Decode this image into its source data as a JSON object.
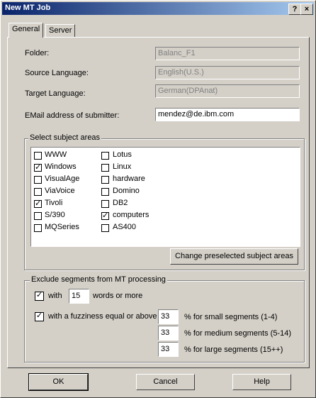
{
  "window": {
    "title": "New MT Job",
    "help_btn": "?",
    "close_btn": "×"
  },
  "tabs": [
    {
      "label": "General"
    },
    {
      "label": "Server"
    }
  ],
  "form": {
    "folder_label": "Folder:",
    "folder_value": "Balanc_F1",
    "source_label": "Source Language:",
    "source_value": "English(U.S.)",
    "target_label": "Target Language:",
    "target_value": "German(DPAnat)",
    "email_label": "EMail address of submitter:",
    "email_value": "mendez@de.ibm.com"
  },
  "subjects": {
    "title": "Select subject areas",
    "col1": [
      {
        "label": "WWW",
        "checked": false,
        "mark": ""
      },
      {
        "label": "Windows",
        "checked": true,
        "mark": "✓"
      },
      {
        "label": "VisualAge",
        "checked": false,
        "mark": ""
      },
      {
        "label": "ViaVoice",
        "checked": false,
        "mark": ""
      },
      {
        "label": "Tivoli",
        "checked": true,
        "mark": "✓"
      },
      {
        "label": "S/390",
        "checked": false,
        "mark": ""
      },
      {
        "label": "MQSeries",
        "checked": false,
        "mark": ""
      }
    ],
    "col2": [
      {
        "label": "Lotus",
        "checked": false,
        "mark": ""
      },
      {
        "label": "Linux",
        "checked": false,
        "mark": ""
      },
      {
        "label": "hardware",
        "checked": false,
        "mark": ""
      },
      {
        "label": "Domino",
        "checked": false,
        "mark": ""
      },
      {
        "label": "DB2",
        "checked": false,
        "mark": ""
      },
      {
        "label": "computers",
        "checked": true,
        "mark": "✓"
      },
      {
        "label": "AS400",
        "checked": false,
        "mark": ""
      }
    ],
    "change_button": "Change preselected subject areas"
  },
  "exclude": {
    "title": "Exclude segments from MT processing",
    "with_mark": "✓",
    "with_label": "with",
    "words_value": "15",
    "words_label": "words or more",
    "fuzzy_mark": "✓",
    "fuzzy_label": "with a fuzziness equal or above",
    "small_value": "33",
    "small_label": "% for small segments (1-4)",
    "medium_value": "33",
    "medium_label": "% for medium segments (5-14)",
    "large_value": "33",
    "large_label": "% for large segments (15++)"
  },
  "buttons": {
    "ok": "OK",
    "cancel": "Cancel",
    "help": "Help"
  }
}
